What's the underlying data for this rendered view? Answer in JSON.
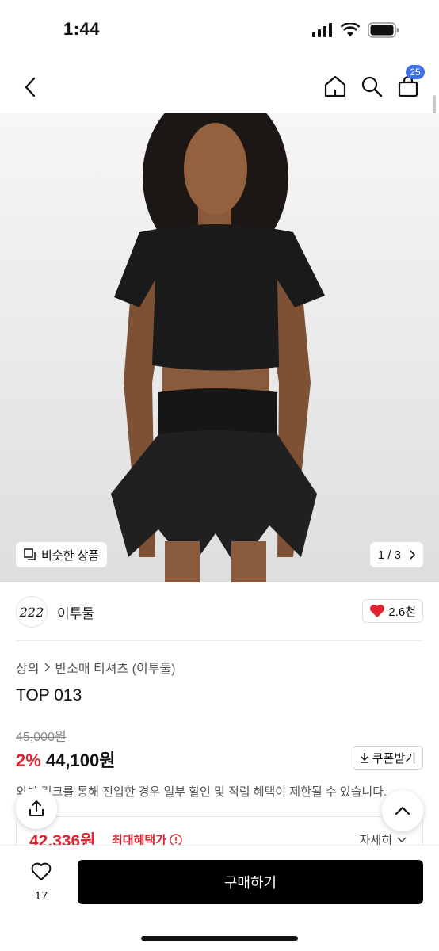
{
  "status": {
    "time": "1:44"
  },
  "header": {
    "cart_count": "25"
  },
  "gallery": {
    "similar_label": "비슷한 상품",
    "pager": "1 / 3"
  },
  "brand": {
    "logo_text": "222",
    "name": "이투둘",
    "likes": "2.6천"
  },
  "product": {
    "breadcrumb": [
      "상의",
      "반소매 티셔츠 (이투둘)"
    ],
    "title": "TOP 013",
    "original_price": "45,000원",
    "discount": "2%",
    "price": "44,100원",
    "coupon_label": "쿠폰받기",
    "notice": "외부 링크를 통해 진입한 경우 일부 할인 및 적립 혜택이 제한될 수 있습니다."
  },
  "benefit": {
    "price": "42,336원",
    "label": "최대혜택가",
    "detail": "자세히"
  },
  "bottom": {
    "wish_count": "17",
    "buy_label": "구매하기"
  },
  "colors": {
    "accent_red": "#e0242f",
    "badge_blue": "#3d6ee6",
    "button_black": "#000000"
  }
}
